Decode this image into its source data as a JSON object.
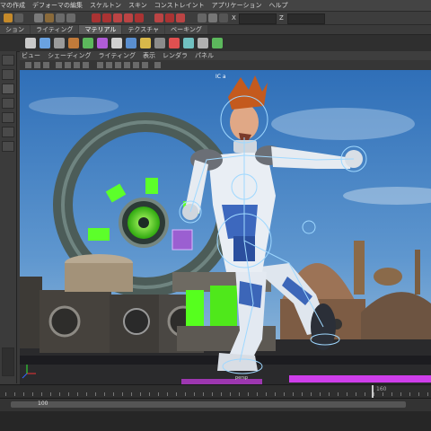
{
  "menubar": {
    "items": [
      "マの作成",
      "デフォーマの編集",
      "スケルトン",
      "スキン",
      "コンストレイント",
      "アプリケーション",
      "ヘルプ"
    ]
  },
  "statusline": {
    "field_x_label": "X",
    "field_z_label": "Z"
  },
  "shelf": {
    "tabs": [
      "ション",
      "ライティング",
      "マテリアル",
      "テクスチャ",
      "ベーキング"
    ],
    "active_index": 2
  },
  "panel": {
    "menu": [
      "ビュー",
      "シェーディング",
      "ライティング",
      "表示",
      "レンダラ",
      "パネル"
    ],
    "camera_label": "IC a",
    "camera_name": "persp"
  },
  "timeslider": {
    "labels": [
      "160"
    ],
    "current_frame": "160"
  },
  "rangeslider": {
    "start_label": "100"
  },
  "colors": {
    "ui_bg": "#3a3a3a",
    "sky": "#3f7fc4",
    "character_hair": "#c45a1e",
    "glow_green": "#5cff2a",
    "neon_magenta": "#e040ff",
    "rig_cyan": "#9fd8ff"
  }
}
